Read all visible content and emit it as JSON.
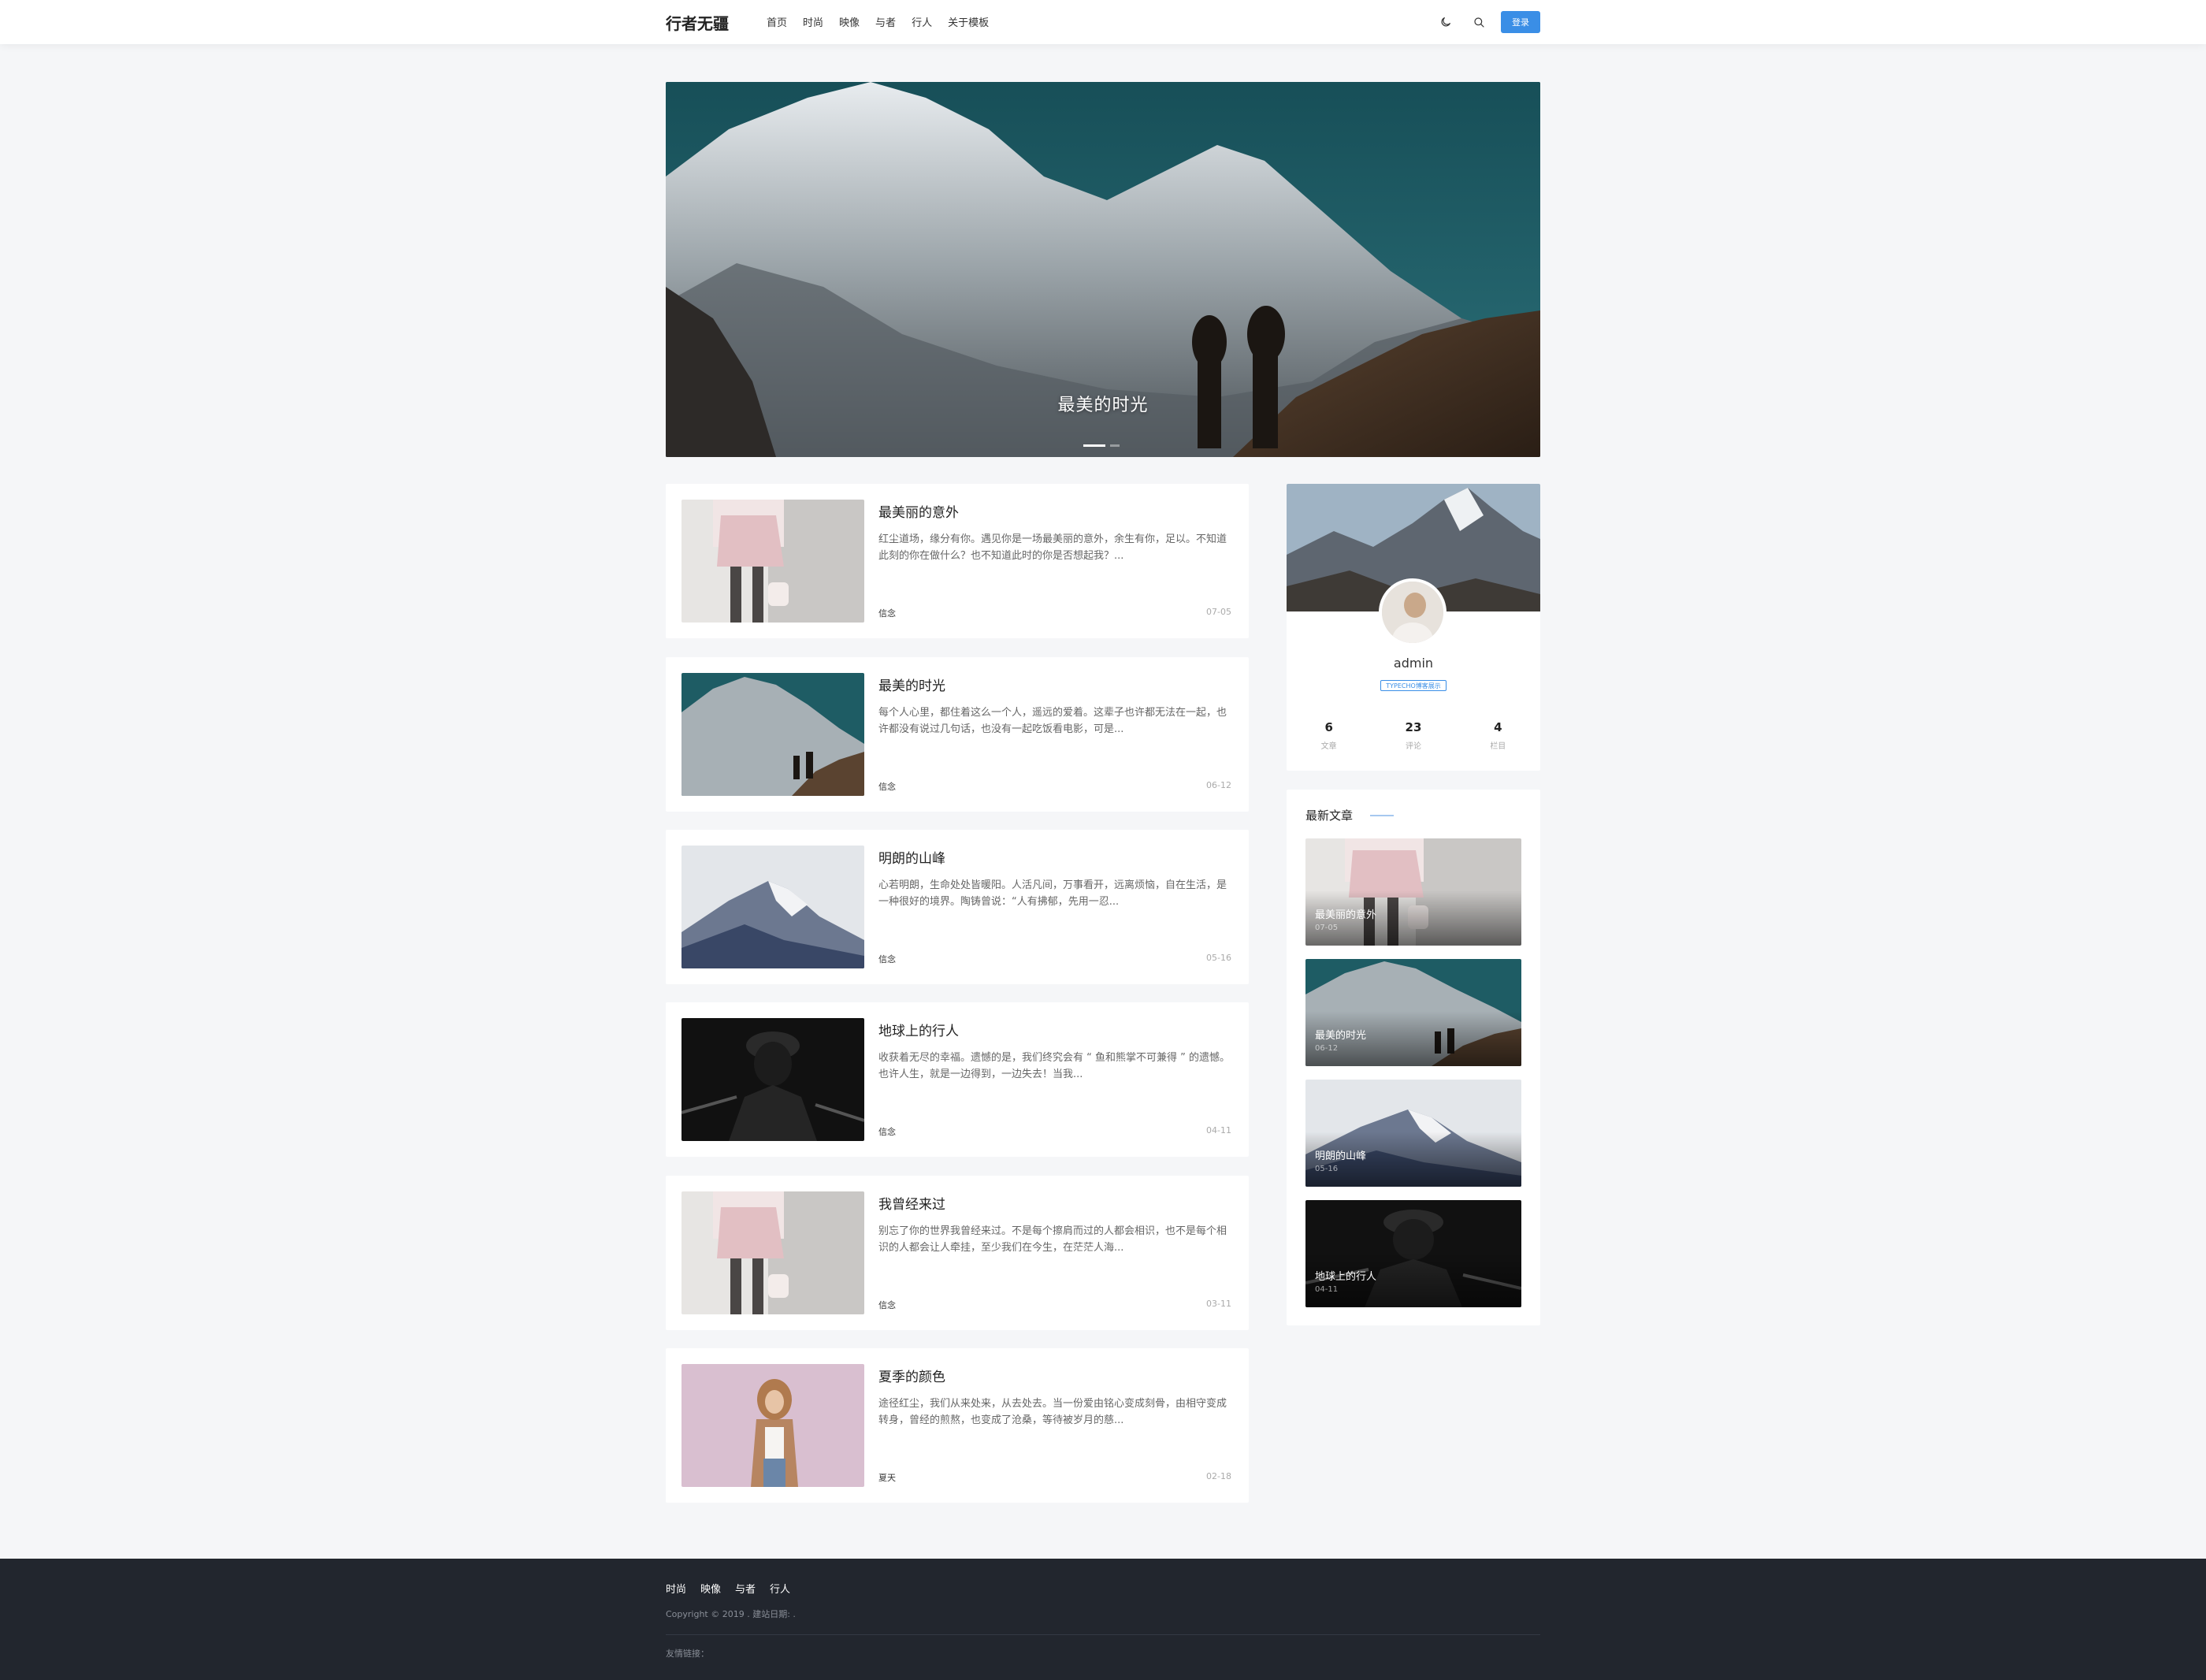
{
  "header": {
    "logo": "行者无疆",
    "nav": [
      "首页",
      "时尚",
      "映像",
      "与者",
      "行人",
      "关于模板"
    ],
    "login_label": "登录",
    "icons": [
      "moon-icon",
      "search-icon"
    ],
    "accent_color": "#3a8ee6"
  },
  "hero": {
    "title": "最美的时光"
  },
  "posts": [
    {
      "title": "最美丽的意外",
      "excerpt": "红尘道场，缘分有你。遇见你是一场最美丽的意外，余生有你，足以。不知道此刻的你在做什么？也不知道此时的你是否想起我？...",
      "category": "信念",
      "date": "07-05"
    },
    {
      "title": "最美的时光",
      "excerpt": "每个人心里，都住着这么一个人，遥远的爱着。这辈子也许都无法在一起，也许都没有说过几句话，也没有一起吃饭看电影，可是...",
      "category": "信念",
      "date": "06-12"
    },
    {
      "title": "明朗的山峰",
      "excerpt": "心若明朗，生命处处皆暖阳。人活凡间，万事看开，远离烦恼，自在生活，是一种很好的境界。陶铸曾说：“人有拂郁，先用一忍...",
      "category": "信念",
      "date": "05-16"
    },
    {
      "title": "地球上的行人",
      "excerpt": "收获着无尽的幸福。遗憾的是，我们终究会有 “ 鱼和熊掌不可兼得 ” 的遗憾。也许人生，就是一边得到，一边失去！当我...",
      "category": "信念",
      "date": "04-11"
    },
    {
      "title": "我曾经来过",
      "excerpt": "别忘了你的世界我曾经来过。不是每个擦肩而过的人都会相识，也不是每个相识的人都会让人牵挂，至少我们在今生，在茫茫人海...",
      "category": "信念",
      "date": "03-11"
    },
    {
      "title": "夏季的颜色",
      "excerpt": "途径红尘，我们从来处来，从去处去。当一份爱由铭心变成刻骨，由相守变成转身，曾经的煎熬，也变成了沧桑，等待被岁月的慈...",
      "category": "夏天",
      "date": "02-18"
    }
  ],
  "profile": {
    "name": "admin",
    "badge": "TYPECHO博客展示",
    "stats": [
      {
        "num": "6",
        "label": "文章"
      },
      {
        "num": "23",
        "label": "评论"
      },
      {
        "num": "4",
        "label": "栏目"
      }
    ]
  },
  "latest": {
    "heading": "最新文章",
    "items": [
      {
        "title": "最美丽的意外",
        "date": "07-05"
      },
      {
        "title": "最美的时光",
        "date": "06-12"
      },
      {
        "title": "明朗的山峰",
        "date": "05-16"
      },
      {
        "title": "地球上的行人",
        "date": "04-11"
      }
    ]
  },
  "footer": {
    "nav": [
      "时尚",
      "映像",
      "与者",
      "行人"
    ],
    "copyright": "Copyright © 2019 . 建站日期: .",
    "friend_links": "友情链接："
  }
}
